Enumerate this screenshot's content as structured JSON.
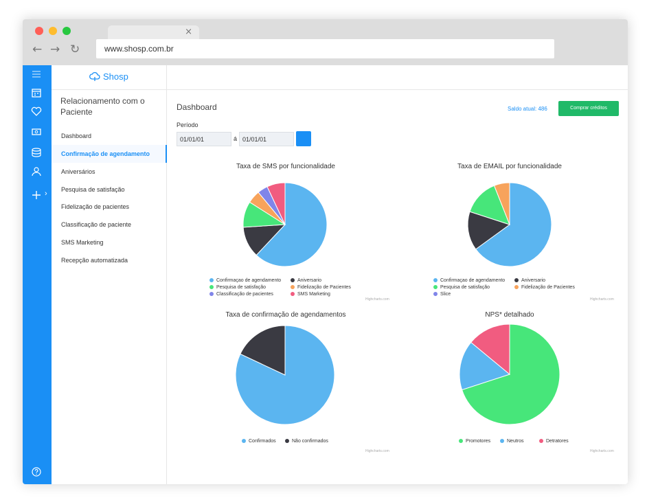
{
  "browser": {
    "tab_close": "×",
    "url": "www.shosp.com.br",
    "traffic_lights": [
      "#ff5f57",
      "#febc2e",
      "#28c840"
    ]
  },
  "iconbar": {
    "icons": [
      "menu-icon",
      "calendar-icon",
      "heart-icon",
      "money-icon",
      "database-icon",
      "users-icon",
      "add-icon",
      "help-icon"
    ],
    "expand": "›"
  },
  "sidebar": {
    "logo": "Shosp",
    "title": "Relacionamento com o Paciente",
    "items": [
      {
        "label": "Dashboard",
        "active": false
      },
      {
        "label": "Confirmação de agendamento",
        "active": true
      },
      {
        "label": "Aniversários",
        "active": false
      },
      {
        "label": "Pesquisa de satisfação",
        "active": false
      },
      {
        "label": "Fidelização de pacientes",
        "active": false
      },
      {
        "label": "Classificação de paciente",
        "active": false
      },
      {
        "label": "SMS Marketing",
        "active": false
      },
      {
        "label": "Recepção automatizada",
        "active": false
      }
    ]
  },
  "main": {
    "title": "Dashboard",
    "saldo": "Saldo atual: 486",
    "buy_button": "Comprar créditos",
    "periodo_label": "Período",
    "date_from": "01/01/01",
    "date_sep": "á",
    "date_to": "01/01/01"
  },
  "colors": {
    "accent": "#1a8ff5",
    "green_button": "#20b968"
  },
  "chart_data": [
    {
      "type": "pie",
      "title": "Taxa de SMS por funcionalidade",
      "credit": "Highcharts.com",
      "series": [
        {
          "name": "Confirmaçao de agendamento",
          "value": 62,
          "color": "#5bb5f0"
        },
        {
          "name": "Aniversario",
          "value": 12,
          "color": "#3a3a42"
        },
        {
          "name": "Pesquisa de satisfação",
          "value": 10,
          "color": "#47e67a"
        },
        {
          "name": "Fidelização de Pacientes",
          "value": 5,
          "color": "#f7a35c"
        },
        {
          "name": "Classificação de pacientes",
          "value": 4,
          "color": "#8085e9"
        },
        {
          "name": "SMS Marketing",
          "value": 7,
          "color": "#f15c80"
        }
      ]
    },
    {
      "type": "pie",
      "title": "Taxa de EMAIL por funcionalidade",
      "credit": "Highcharts.com",
      "series": [
        {
          "name": "Confirmaçao de agendamento",
          "value": 65,
          "color": "#5bb5f0"
        },
        {
          "name": "Aniversario",
          "value": 15,
          "color": "#3a3a42"
        },
        {
          "name": "Pesquisa de satisfação",
          "value": 14,
          "color": "#47e67a"
        },
        {
          "name": "Fidelização de Pacientes",
          "value": 6,
          "color": "#f7a35c"
        },
        {
          "name": "Slice",
          "value": 0,
          "color": "#8085e9"
        }
      ]
    },
    {
      "type": "pie",
      "title": "Taxa de confirmação de agendamentos",
      "credit": "Highcharts.com",
      "series": [
        {
          "name": "Confirmados",
          "value": 82,
          "color": "#5bb5f0"
        },
        {
          "name": "Não confirmados",
          "value": 18,
          "color": "#3a3a42"
        }
      ]
    },
    {
      "type": "pie",
      "title": "NPS* detalhado",
      "credit": "Highcharts.com",
      "series": [
        {
          "name": "Promotores",
          "value": 70,
          "color": "#47e67a"
        },
        {
          "name": "Neutros",
          "value": 16,
          "color": "#5bb5f0"
        },
        {
          "name": "Detratores",
          "value": 14,
          "color": "#f15c80"
        }
      ]
    }
  ]
}
